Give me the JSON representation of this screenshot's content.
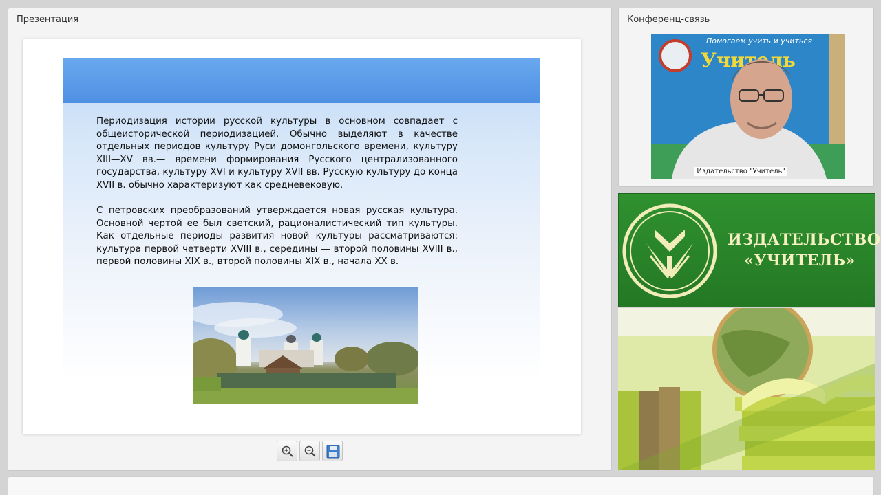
{
  "presentation": {
    "title": "Презентация",
    "slide": {
      "paragraph1": "Периодизация истории русской культуры в основном совпадает с общеисторической периодизацией. Обычно выделяют в качестве отдельных периодов культуру Руси домонгольского времени, культуру XIII—XV вв.— времени формирования Русского централизованного государства, культуру XVI и культуру XVII вв. Русскую культуру до конца XVII в. обычно характеризуют как средневековую.",
      "paragraph2": "С петровских преобразований утверждается новая русская культура. Основной чертой ее был светский, рационалистический тип культуры. Как отдельные периоды развития новой культуры рассматриваются: культура первой четверти XVIII в., середины — второй половины XVIII в., первой половины XIX в., второй половины XIX в., начала XX в."
    },
    "toolbar": {
      "zoom_in_icon": "zoom-in-icon",
      "zoom_out_icon": "zoom-out-icon",
      "save_icon": "save-icon"
    }
  },
  "conference": {
    "title": "Конференц-связь",
    "video_label": "Издательство \"Учитель\"",
    "video_banner_top": "Помогаем учить и учиться",
    "video_banner_brand": "Учитель"
  },
  "banner": {
    "line1": "ИЗДАТЕЛЬСТВО",
    "line2": "«УЧИТЕЛЬ»"
  },
  "colors": {
    "banner_green": "#2b8a2b",
    "banner_text": "#f7f0c2",
    "slide_header_blue": "#5b9be8"
  }
}
